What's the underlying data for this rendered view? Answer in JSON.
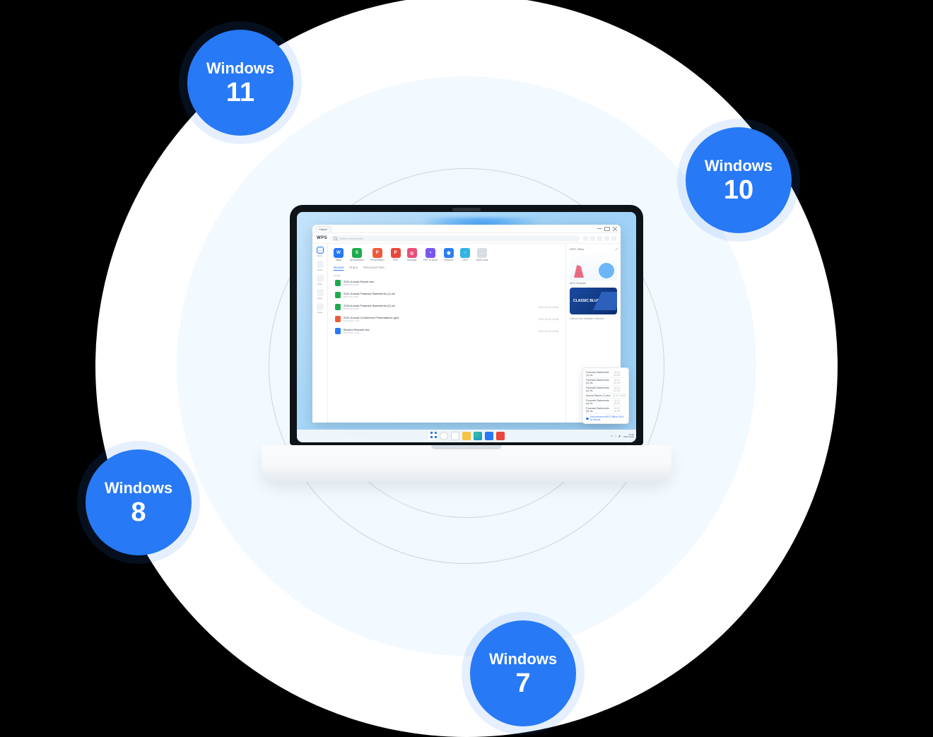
{
  "os_badges": [
    {
      "name": "Windows",
      "version": "11"
    },
    {
      "name": "Windows",
      "version": "10"
    },
    {
      "name": "Windows",
      "version": "8"
    },
    {
      "name": "Windows",
      "version": "7"
    }
  ],
  "colors": {
    "accent": "#2779f6",
    "badge_halo": "rgba(39,121,246,0.12)",
    "outer_bg": "#f2f9ff"
  },
  "app": {
    "tab": "Home",
    "logo": "WPS",
    "search_placeholder": "Search documents",
    "side_nav": [
      {
        "label": "Home"
      },
      {
        "label": "Docs"
      },
      {
        "label": "Open"
      },
      {
        "label": "Apps"
      },
      {
        "label": "Tools"
      }
    ],
    "start": [
      {
        "label": "Write",
        "glyph": "W",
        "color": "#2779f6"
      },
      {
        "label": "Spreadsheet",
        "glyph": "S",
        "color": "#1fab4d"
      },
      {
        "label": "Presentation",
        "glyph": "P",
        "color": "#ef5b3a"
      },
      {
        "label": "PDF",
        "glyph": "P",
        "color": "#e8463b"
      },
      {
        "label": "Template",
        "glyph": "◎",
        "color": "#e94e7a"
      },
      {
        "label": "PDF to Word",
        "glyph": "◑",
        "color": "#7a56f0"
      },
      {
        "label": "Resume",
        "glyph": "⬢",
        "color": "#2a7ef3"
      },
      {
        "label": "OCR",
        "glyph": "○",
        "color": "#2fb5e5"
      },
      {
        "label": "More tools",
        "glyph": "…",
        "color": "#d7dde3"
      }
    ],
    "filters": [
      {
        "label": "Recent",
        "active": true
      },
      {
        "label": "Share",
        "active": false
      },
      {
        "label": "Received Files",
        "active": false
      }
    ],
    "section_label": "Today",
    "files": [
      {
        "name": "2021 Annual Report.xlsx",
        "path": "WPS Cloud File",
        "date": "",
        "color": "#1fab4d"
      },
      {
        "name": "2021 Annual Financial Statements (1).xls",
        "path": "WPS Cloud File",
        "date": "",
        "color": "#1fab4d"
      },
      {
        "name": "2020 Annual Financial Statements (2).xls",
        "path": "WPS Cloud File",
        "date": "2021-12-22 10:36",
        "color": "#1fab4d"
      },
      {
        "name": "2021 Annual Conference Presentation1.pptx",
        "path": "My Device > Doc",
        "date": "2021-12-22 10:36",
        "color": "#ef5b3a"
      },
      {
        "name": "Bovar's Resume.doc",
        "path": "My Device > Doc",
        "date": "2021-12-22 10:36",
        "color": "#2779f6"
      }
    ],
    "right_panel": {
      "title": "WPS Office",
      "tag": "WPS Template",
      "card_label": "CLASSIC BLUE",
      "subtitle": "Classic blue template collection"
    },
    "floater": {
      "rows": [
        {
          "name": "Financial Statements (1).xls",
          "date": "12-22 10:36"
        },
        {
          "name": "Financial Statements (2).xls",
          "date": "12-22 10:36"
        },
        {
          "name": "Financial Statements (3).xls",
          "date": "12-22 10:36"
        },
        {
          "name": "Annual Report (1).xlsx",
          "date": "12-22 10:36"
        },
        {
          "name": "Financial Statements (4).xls",
          "date": "12-22 10:36"
        },
        {
          "name": "Financial Statements (5).xls",
          "date": "12-22 10:36"
        }
      ],
      "link": "Recommend WPS Office 2019 to friends"
    }
  },
  "taskbar": {
    "date": "2021/12/22",
    "time": "10:36"
  }
}
